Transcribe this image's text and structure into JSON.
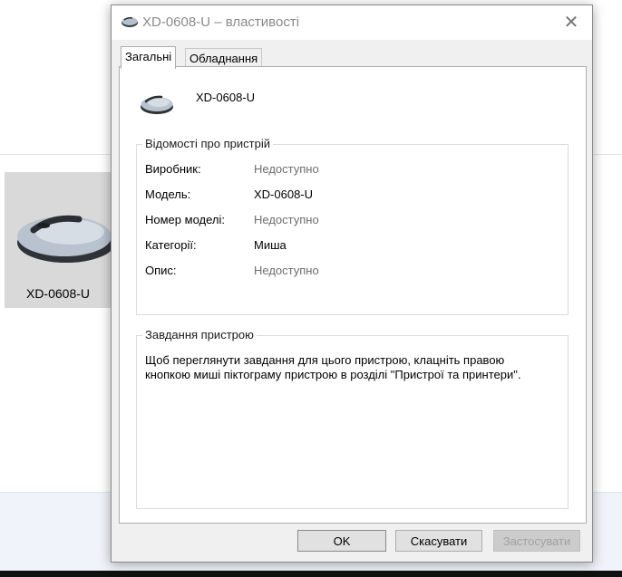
{
  "background": {
    "device_label": "XD-0608-U"
  },
  "dialog": {
    "title": "XD-0608-U – властивості",
    "tabs": [
      {
        "label": "Загальні",
        "active": true
      },
      {
        "label": "Обладнання",
        "active": false
      }
    ],
    "device_name": "XD-0608-U",
    "info": {
      "title": "Відомості про пристрій",
      "rows": [
        {
          "key": "Виробник:",
          "value": "Недоступно",
          "muted": true
        },
        {
          "key": "Модель:",
          "value": "XD-0608-U",
          "muted": false
        },
        {
          "key": "Номер моделі:",
          "value": "Недоступно",
          "muted": true
        },
        {
          "key": "Категорії:",
          "value": "Миша",
          "muted": false
        },
        {
          "key": "Опис:",
          "value": "Недоступно",
          "muted": true
        }
      ]
    },
    "tasks": {
      "title": "Завдання пристрою",
      "text": "Щоб переглянути завдання для цього пристрою, клацніть правою кнопкою миші піктограму пристрою в розділі \"Пристрої та принтери\"."
    },
    "buttons": {
      "ok": "OK",
      "cancel": "Скасувати",
      "apply": "Застосувати"
    }
  }
}
